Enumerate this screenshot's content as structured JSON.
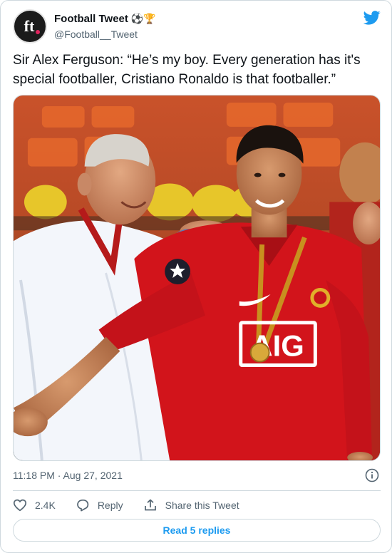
{
  "author": {
    "display_name": "Football Tweet",
    "name_emoji": "⚽️🏆",
    "handle": "@Football__Tweet",
    "avatar_text": "ft"
  },
  "tweet": {
    "text": "Sir Alex Ferguson: “He’s my boy. Every generation has it's special footballer, Cristiano Ronaldo is that footballer.”",
    "timestamp": "11:18 PM · Aug 27, 2021"
  },
  "actions": {
    "like_count": "2.4K",
    "reply_label": "Reply",
    "share_label": "Share this Tweet"
  },
  "footer": {
    "read_replies_label": "Read 5 replies"
  },
  "media": {
    "shirt_text": "AIG"
  },
  "colors": {
    "accent": "#1d9bf0",
    "text": "#0f1419",
    "muted": "#536471",
    "border": "#cfd9de"
  },
  "icons": [
    "twitter-bird-icon",
    "info-icon",
    "heart-icon",
    "reply-icon",
    "share-icon"
  ]
}
